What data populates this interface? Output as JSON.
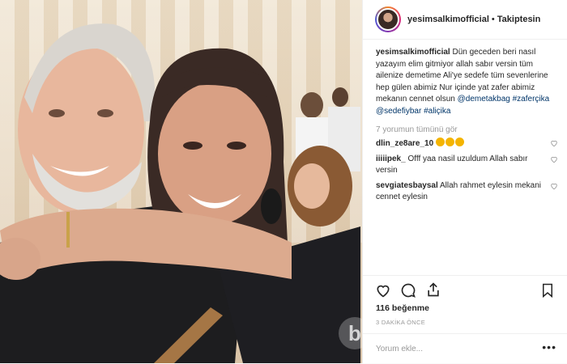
{
  "header": {
    "username": "yesimsalkimofficial",
    "separator": "•",
    "follow_state": "Takiptesin"
  },
  "caption": {
    "username": "yesimsalkimofficial",
    "text": "Dün geceden beri nasıl yazayım elim gitmiyor allah sabır versin tüm ailenize demetime Ali'ye sedefe tüm sevenlerine hep gülen abimiz Nur içinde yat zafer abimiz mekanın cennet olsun",
    "tags": [
      "@demetakbag",
      "#zaferçika",
      "@sedefiybar",
      "#aliçika"
    ]
  },
  "view_all_comments": "7 yorumun tümünü gör",
  "comments": [
    {
      "user": "dlin_ze8are_10",
      "text": "",
      "emoji_count": 3,
      "emoji": "clapping-hands"
    },
    {
      "user": "iiiiipek_",
      "text": "Offf yaa nasil uzuldum Allah sabır versin"
    },
    {
      "user": "sevgiatesbaysal",
      "text": "Allah rahmet eylesin mekani cennet eylesin"
    }
  ],
  "actions": {
    "like_icon": "heart-icon",
    "comment_icon": "comment-icon",
    "share_icon": "share-icon",
    "save_icon": "bookmark-icon"
  },
  "likes": "116 beğenme",
  "time_ago": "3 DAKİKA ÖNCE",
  "add_comment": {
    "placeholder": "Yorum ekle...",
    "more": "•••"
  },
  "watermark_text": "b",
  "colors": {
    "text": "#262626",
    "muted": "#999999",
    "link": "#003569",
    "border": "#efefef"
  }
}
